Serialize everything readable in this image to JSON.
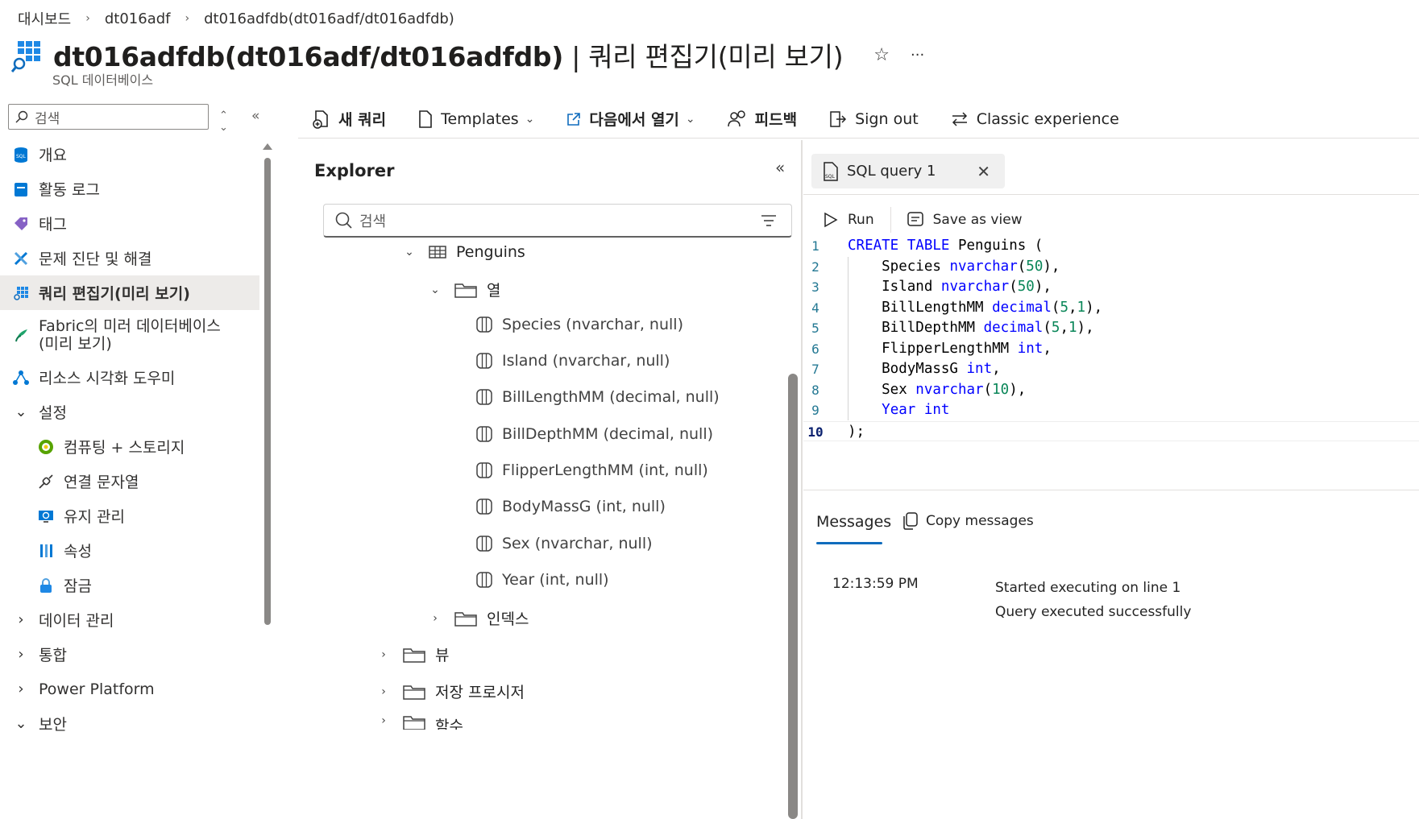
{
  "breadcrumb": [
    "대시보드",
    "dt016adf",
    "dt016adfdb(dt016adf/dt016adfdb)"
  ],
  "header": {
    "title_main": "dt016adfdb(dt016adf/dt016adfdb)",
    "title_suffix": " | 쿼리 편집기(미리 보기)",
    "subtitle": "SQL 데이터베이스",
    "favorite_icon": "star-icon",
    "more_icon": "more-icon"
  },
  "nav": {
    "search_placeholder": "검색",
    "items": [
      {
        "label": "개요",
        "icon": "sql-database-icon"
      },
      {
        "label": "활동 로그",
        "icon": "activity-log-icon"
      },
      {
        "label": "태그",
        "icon": "tag-icon"
      },
      {
        "label": "문제 진단 및 해결",
        "icon": "wrench-icon"
      },
      {
        "label": "쿼리 편집기(미리 보기)",
        "icon": "query-editor-icon"
      },
      {
        "label": "Fabric의 미러 데이터베이스(미리 보기)",
        "icon": "fabric-icon"
      },
      {
        "label": "리소스 시각화 도우미",
        "icon": "resource-visualizer-icon"
      },
      {
        "label": "설정",
        "icon": "chevron-down-icon"
      },
      {
        "label": "컴퓨팅 + 스토리지",
        "icon": "compute-icon"
      },
      {
        "label": "연결 문자열",
        "icon": "connection-string-icon"
      },
      {
        "label": "유지 관리",
        "icon": "maintenance-icon"
      },
      {
        "label": "속성",
        "icon": "properties-icon"
      },
      {
        "label": "잠금",
        "icon": "lock-icon"
      },
      {
        "label": "데이터 관리",
        "icon": "chevron-right-icon"
      },
      {
        "label": "통합",
        "icon": "chevron-right-icon"
      },
      {
        "label": "Power Platform",
        "icon": "chevron-right-icon"
      },
      {
        "label": "보안",
        "icon": "chevron-down-icon"
      }
    ]
  },
  "toolbar": {
    "new_query": "새 쿼리",
    "templates": "Templates",
    "open_in": "다음에서 열기",
    "feedback": "피드백",
    "sign_out": "Sign out",
    "classic": "Classic experience"
  },
  "explorer": {
    "title": "Explorer",
    "search_placeholder": "검색",
    "table": "Penguins",
    "columns_folder": "열",
    "columns": [
      "Species (nvarchar, null)",
      "Island (nvarchar, null)",
      "BillLengthMM (decimal, null)",
      "BillDepthMM (decimal, null)",
      "FlipperLengthMM (int, null)",
      "BodyMassG (int, null)",
      "Sex (nvarchar, null)",
      "Year (int, null)"
    ],
    "indexes_folder": "인덱스",
    "views_folder": "뷰",
    "procs_folder": "저장 프로시저",
    "functions_folder": "함수"
  },
  "editor": {
    "tab_label": "SQL query 1",
    "run": "Run",
    "save_as_view": "Save as view",
    "line_numbers": [
      "1",
      "2",
      "3",
      "4",
      "5",
      "6",
      "7",
      "8",
      "9",
      "10"
    ]
  },
  "messages": {
    "tab_label": "Messages",
    "copy_label": "Copy messages",
    "time": "12:13:59 PM",
    "line1": "Started executing on line 1",
    "line2": "Query executed successfully"
  },
  "colors": {
    "accent": "#0f6cbd",
    "keyword": "#0000ff",
    "number": "#098658",
    "line_number": "#237893"
  }
}
